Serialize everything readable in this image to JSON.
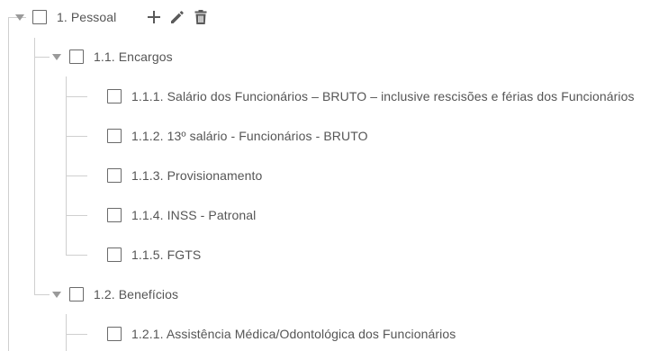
{
  "tree": {
    "root": {
      "label": "1. Pessoal",
      "actions": {
        "add_icon": "plus-icon",
        "edit_icon": "pencil-icon",
        "delete_icon": "trash-icon"
      }
    },
    "groups": [
      {
        "label": "1.1. Encargos",
        "items": [
          {
            "label": "1.1.1. Salário dos Funcionários – BRUTO – inclusive rescisões e férias dos Funcionários"
          },
          {
            "label": "1.1.2. 13º salário - Funcionários - BRUTO"
          },
          {
            "label": "1.1.3. Provisionamento"
          },
          {
            "label": "1.1.4. INSS - Patronal"
          },
          {
            "label": "1.1.5. FGTS"
          }
        ]
      },
      {
        "label": "1.2. Benefícios",
        "items": [
          {
            "label": "1.2.1. Assistência Médica/Odontológica dos Funcionários"
          }
        ]
      }
    ]
  },
  "colors": {
    "text": "#555555",
    "connector": "#cfcfcf",
    "checkbox_border": "#6a6a6a",
    "icon": "#5a5a5a"
  }
}
